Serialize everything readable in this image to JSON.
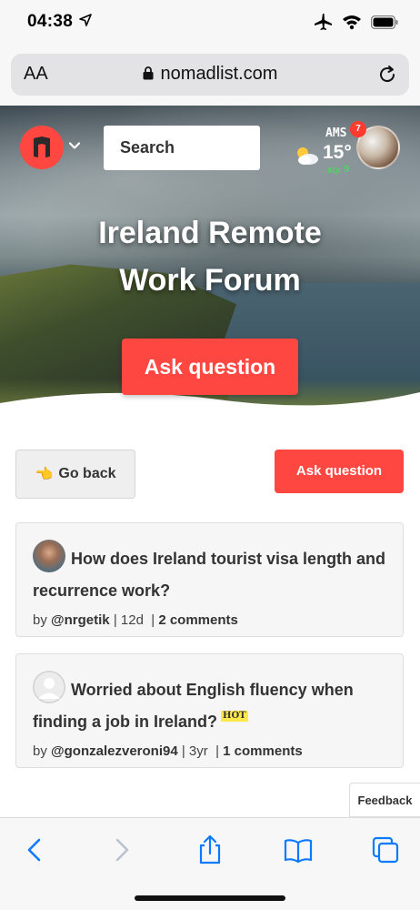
{
  "status_bar": {
    "time": "04:38"
  },
  "browser": {
    "text_size_label": "AA",
    "url": "nomadlist.com"
  },
  "header": {
    "search_placeholder": "Search",
    "weather": {
      "city": "AMS",
      "temperature": "15°",
      "aqi_label": "AQI",
      "aqi_value": "9"
    },
    "notification_count": "7"
  },
  "hero": {
    "title": "Ireland Remote Work Forum",
    "ask_button": "Ask question"
  },
  "actions": {
    "go_back_icon": "👈",
    "go_back_label": "Go back",
    "ask_label": "Ask question"
  },
  "posts": [
    {
      "title": "How does Ireland tourist visa length and recurrence work?",
      "author": "@nrgetik",
      "age": "12d",
      "comments": "2 comments",
      "hot": ""
    },
    {
      "title": "Worried about English fluency when finding a job in Ireland?",
      "author": "@gonzalezveroni94",
      "age": "3yr",
      "comments": "1 comments",
      "hot": "HOT"
    }
  ],
  "feedback_label": "Feedback",
  "colors": {
    "brand_red": "#ff4742",
    "aqi_green": "#49d85f",
    "ios_blue": "#0a7aff"
  },
  "toolbar": {
    "icons": [
      "back-icon",
      "forward-icon",
      "share-icon",
      "bookmarks-icon",
      "tabs-icon"
    ]
  }
}
